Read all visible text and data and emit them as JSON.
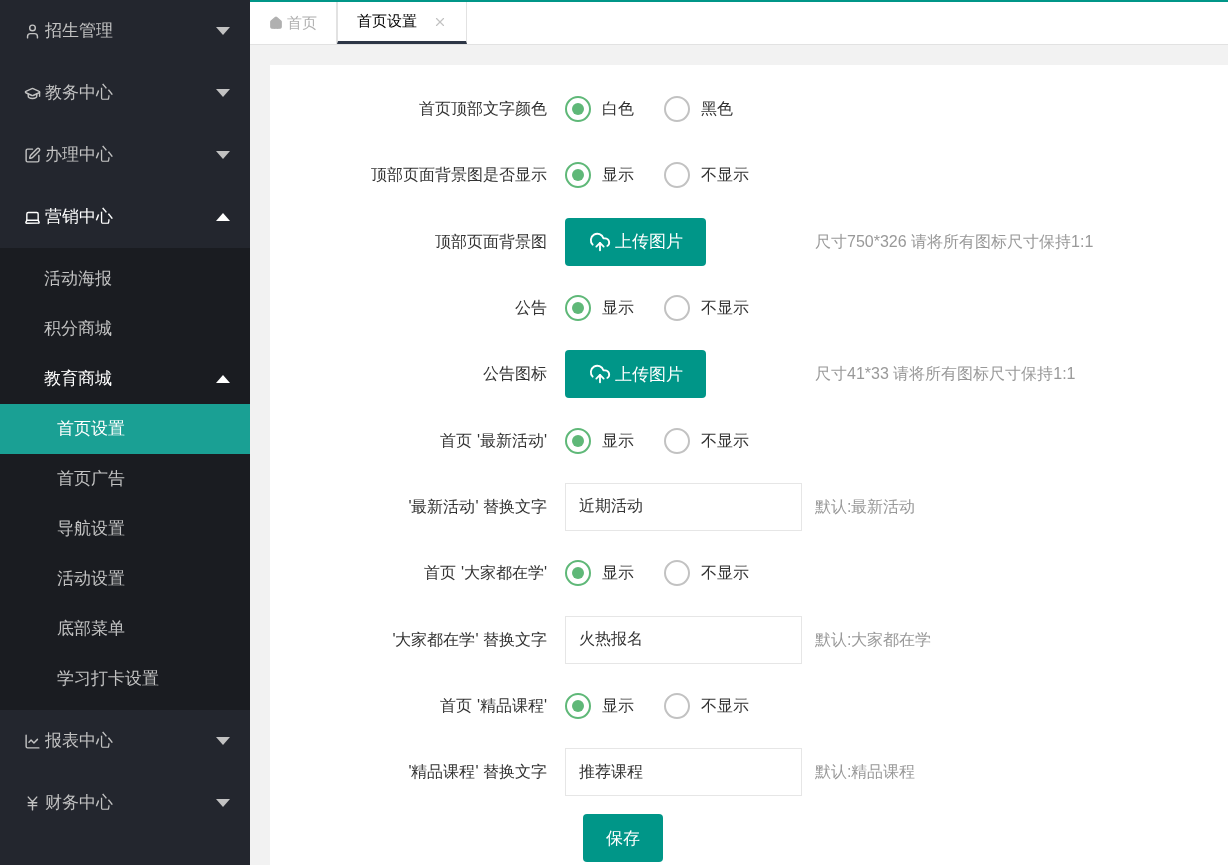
{
  "sidebar": {
    "items": [
      {
        "label": "招生管理",
        "expanded": false
      },
      {
        "label": "教务中心",
        "expanded": false
      },
      {
        "label": "办理中心",
        "expanded": false
      },
      {
        "label": "营销中心",
        "expanded": true,
        "children": [
          {
            "label": "活动海报",
            "expanded": false,
            "selected": false
          },
          {
            "label": "积分商城",
            "expanded": false,
            "selected": false
          },
          {
            "label": "教育商城",
            "expanded": true,
            "selected": false,
            "children": [
              {
                "label": "首页设置",
                "selected": true
              },
              {
                "label": "首页广告",
                "selected": false
              },
              {
                "label": "导航设置",
                "selected": false
              },
              {
                "label": "活动设置",
                "selected": false
              },
              {
                "label": "底部菜单",
                "selected": false
              },
              {
                "label": "学习打卡设置",
                "selected": false
              }
            ]
          }
        ]
      },
      {
        "label": "报表中心",
        "expanded": false
      },
      {
        "label": "财务中心",
        "expanded": false
      }
    ]
  },
  "tabs": [
    {
      "kind": "home",
      "label": "首页",
      "selected": false
    },
    {
      "kind": "page",
      "label": "首页设置",
      "selected": true
    }
  ],
  "form": {
    "rows": [
      {
        "kind": "radio",
        "label": "首页顶部文字颜色",
        "options": [
          {
            "label": "白色",
            "selected": true
          },
          {
            "label": "黑色",
            "selected": false
          }
        ]
      },
      {
        "kind": "radio",
        "label": "顶部页面背景图是否显示",
        "options": [
          {
            "label": "显示",
            "selected": true
          },
          {
            "label": "不显示",
            "selected": false
          }
        ]
      },
      {
        "kind": "upload",
        "label": "顶部页面背景图",
        "button": "上传图片",
        "hint": "尺寸750*326 请将所有图标尺寸保持1:1"
      },
      {
        "kind": "radio",
        "label": "公告",
        "options": [
          {
            "label": "显示",
            "selected": true
          },
          {
            "label": "不显示",
            "selected": false
          }
        ]
      },
      {
        "kind": "upload",
        "label": "公告图标",
        "button": "上传图片",
        "hint": "尺寸41*33 请将所有图标尺寸保持1:1"
      },
      {
        "kind": "radio",
        "label": "首页 '最新活动'",
        "options": [
          {
            "label": "显示",
            "selected": true
          },
          {
            "label": "不显示",
            "selected": false
          }
        ]
      },
      {
        "kind": "text",
        "label": "'最新活动' 替换文字",
        "value": "近期活动",
        "hint": "默认:最新活动"
      },
      {
        "kind": "radio",
        "label": "首页 '大家都在学'",
        "options": [
          {
            "label": "显示",
            "selected": true
          },
          {
            "label": "不显示",
            "selected": false
          }
        ]
      },
      {
        "kind": "text",
        "label": "'大家都在学' 替换文字",
        "value": "火热报名",
        "hint": "默认:大家都在学"
      },
      {
        "kind": "radio",
        "label": "首页 '精品课程'",
        "options": [
          {
            "label": "显示",
            "selected": true
          },
          {
            "label": "不显示",
            "selected": false
          }
        ]
      },
      {
        "kind": "text",
        "label": "'精品课程' 替换文字",
        "value": "推荐课程",
        "hint": "默认:精品课程"
      }
    ],
    "save": "保存"
  }
}
